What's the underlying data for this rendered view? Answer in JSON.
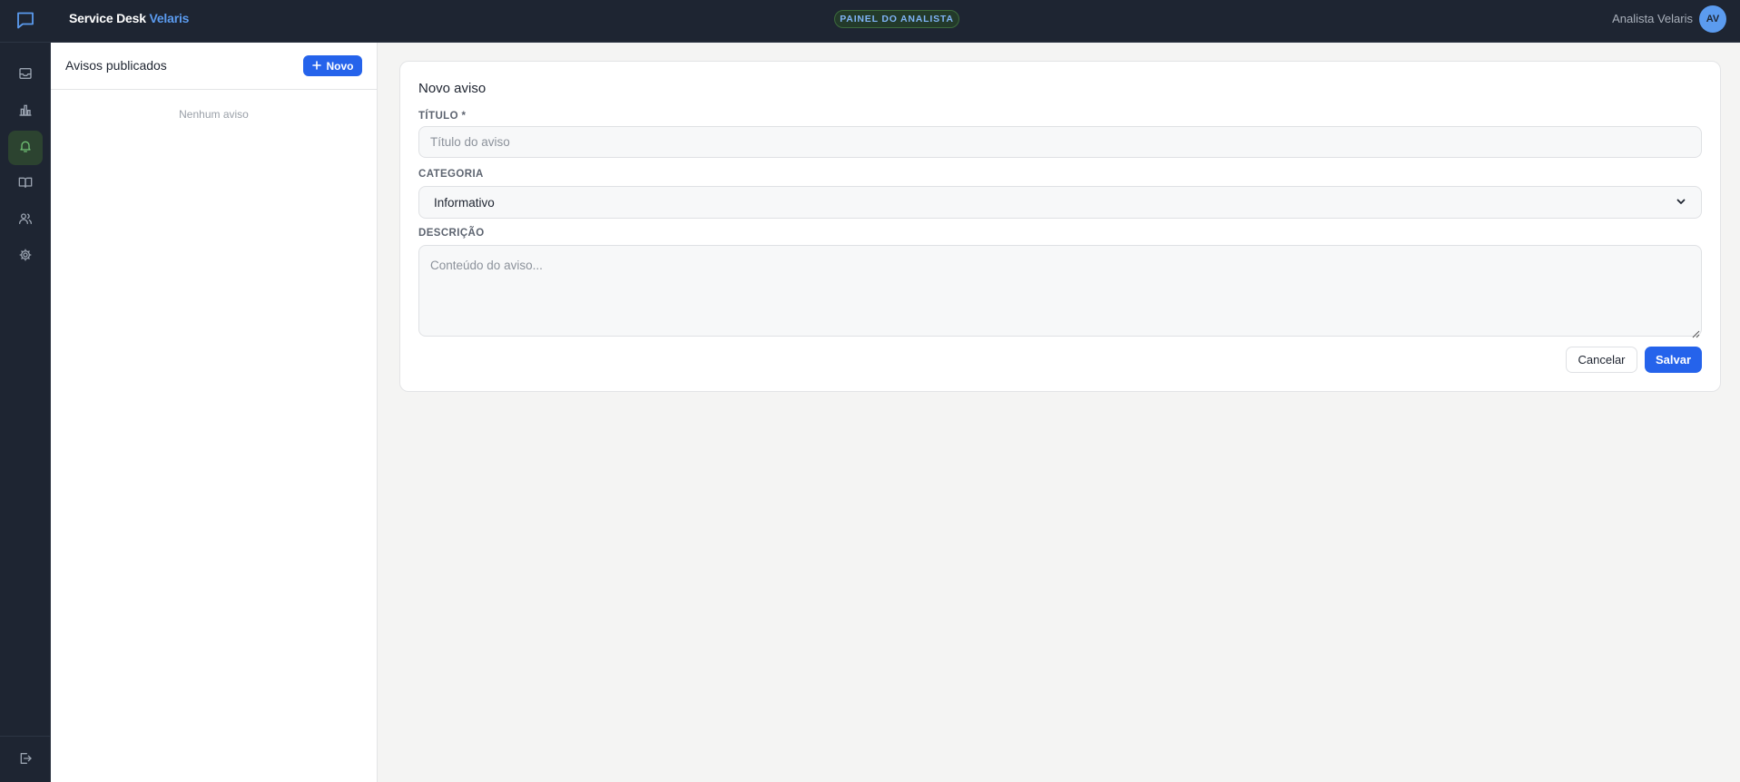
{
  "app": {
    "brand_primary": "Service Desk",
    "brand_accent": "Velaris",
    "panel_badge": "PAINEL DO ANALISTA",
    "user_name": "Analista Velaris",
    "user_initials": "AV"
  },
  "rail": {
    "items": [
      {
        "icon": "inbox-icon",
        "active": false
      },
      {
        "icon": "bar-chart-icon",
        "active": false
      },
      {
        "icon": "bell-icon",
        "active": true
      },
      {
        "icon": "book-icon",
        "active": false
      },
      {
        "icon": "users-icon",
        "active": false
      },
      {
        "icon": "gear-icon",
        "active": false
      }
    ],
    "footer_icon": "logout-icon"
  },
  "list": {
    "title": "Avisos publicados",
    "new_button": "Novo",
    "empty_text": "Nenhum aviso"
  },
  "form": {
    "title": "Novo aviso",
    "title_label": "TÍTULO *",
    "title_placeholder": "Título do aviso",
    "title_value": "",
    "category_label": "CATEGORIA",
    "category_value": "Informativo",
    "description_label": "DESCRIÇÃO",
    "description_placeholder": "Conteúdo do aviso...",
    "description_value": "",
    "cancel_label": "Cancelar",
    "save_label": "Salvar"
  },
  "colors": {
    "topbar_bg": "#1e2532",
    "accent_blue": "#2563eb",
    "brand_blue": "#5b9bef",
    "active_rail_bg": "#2c4330",
    "active_icon": "#6fbf73"
  }
}
